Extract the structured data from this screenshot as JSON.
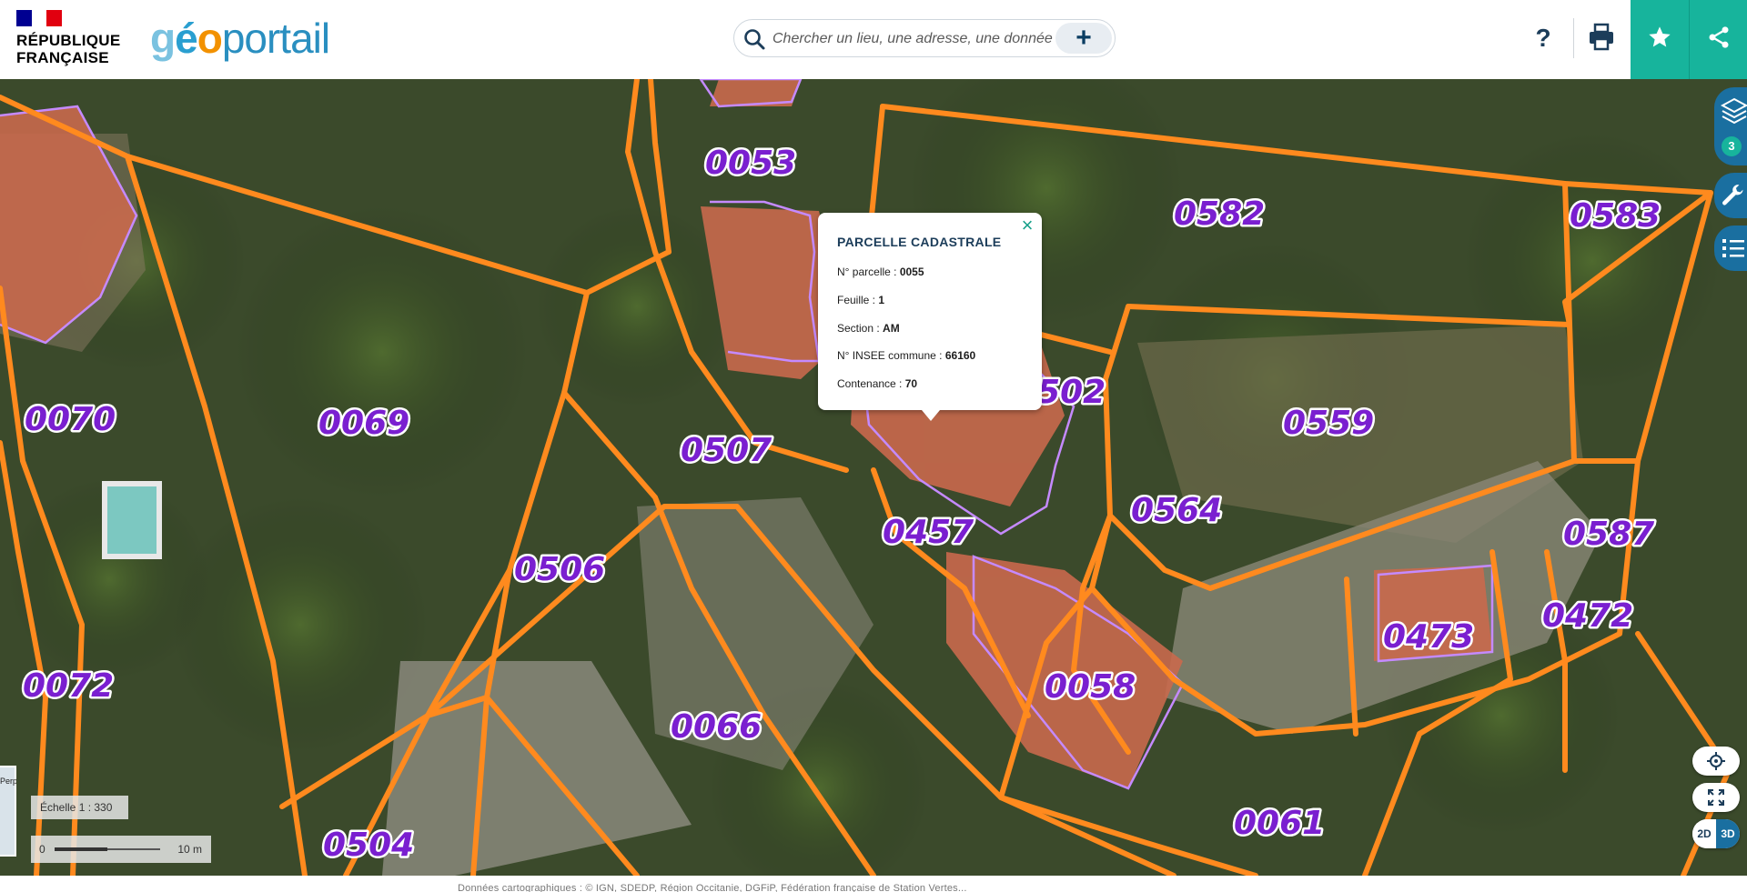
{
  "header": {
    "rf_line1": "RÉPUBLIQUE",
    "rf_line2": "FRANÇAISE",
    "logo_geo_g": "g",
    "logo_geo_e": "é",
    "logo_geo_o": "o",
    "logo_portail": "portail",
    "search_placeholder": "Chercher un lieu, une adresse, une donnée",
    "search_plus": "+",
    "help": "?"
  },
  "colors": {
    "accent": "#17b49c",
    "toolbar_blue": "#1a6fa0",
    "parcel_border": "#ff8a1e",
    "building_border": "#c58aff",
    "label_color": "#7a1fd0"
  },
  "icons": {
    "search": "search-icon",
    "print": "print-icon",
    "favorite": "star-icon",
    "share": "share-icon",
    "layers": "layers-icon",
    "tools": "wrench-icon",
    "legend": "list-icon",
    "locate": "crosshair-icon",
    "fullscreen": "expand-icon",
    "close": "close-icon"
  },
  "popup": {
    "title": "PARCELLE CADASTRALE",
    "close": "×",
    "rows": [
      {
        "label": "N° parcelle : ",
        "value": "0055"
      },
      {
        "label": "Feuille : ",
        "value": "1"
      },
      {
        "label": "Section : ",
        "value": "AM"
      },
      {
        "label": "N° INSEE commune : ",
        "value": "66160"
      },
      {
        "label": "Contenance : ",
        "value": "70"
      }
    ]
  },
  "parcels": [
    "0053",
    "0582",
    "0583",
    "0070",
    "0069",
    "0055",
    "0502",
    "0559",
    "0507",
    "0564",
    "0587",
    "0457",
    "0506",
    "0472",
    "0473",
    "0072",
    "0058",
    "0066",
    "0061",
    "0504"
  ],
  "toolbar": {
    "layers_count": "3",
    "dim_2d": "2D",
    "dim_3d": "3D"
  },
  "scale": {
    "label": "Échelle 1 : 330",
    "zero": "0",
    "distance": "10 m"
  },
  "minimap": {
    "label": "Perpig"
  },
  "footer": {
    "attribution": "Données cartographiques : © IGN, SDEDP, Région Occitanie, DGFiP, Fédération française de Station Vertes..."
  }
}
